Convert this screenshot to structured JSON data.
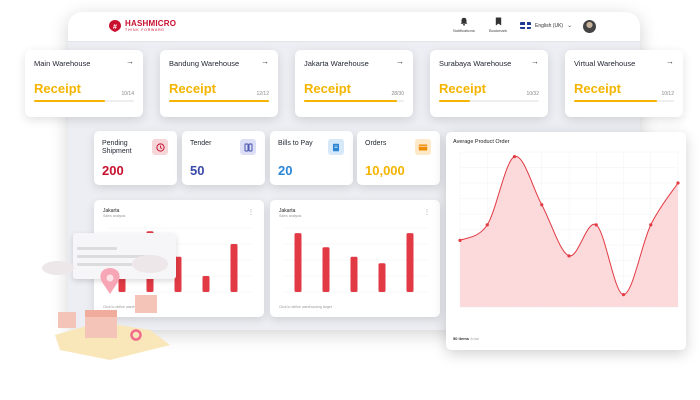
{
  "brand": {
    "name": "HASHMICRO",
    "tagline": "THINK FORWARD"
  },
  "topbar": {
    "notifications_label": "Notifications",
    "bookmark_label": "Bookmark",
    "language": "English (UK)"
  },
  "warehouses": [
    {
      "name": "Main Warehouse",
      "label": "Receipt",
      "count": "10/14",
      "progress": 0.71
    },
    {
      "name": "Bandung Warehouse",
      "label": "Receipt",
      "count": "12/12",
      "progress": 1.0
    },
    {
      "name": "Jakarta Warehouse",
      "label": "Receipt",
      "count": "28/30",
      "progress": 0.93
    },
    {
      "name": "Surabaya Warehouse",
      "label": "Receipt",
      "count": "10/32",
      "progress": 0.31
    },
    {
      "name": "Virtual Warehouse",
      "label": "Receipt",
      "count": "10/12",
      "progress": 0.83
    }
  ],
  "stats": [
    {
      "title": "Pending Shipment",
      "value": "200",
      "color": "#c8102e",
      "icon": "clock-icon",
      "icon_bg": "#f7d6d9",
      "icon_fg": "#c8102e"
    },
    {
      "title": "Tender",
      "value": "50",
      "color": "#3a49a8",
      "icon": "tender-icon",
      "icon_bg": "#dcdff5",
      "icon_fg": "#3a49a8"
    },
    {
      "title": "Bills to Pay",
      "value": "20",
      "color": "#2a86d6",
      "icon": "document-icon",
      "icon_bg": "#d7e8f8",
      "icon_fg": "#2a86d6"
    },
    {
      "title": "Orders",
      "value": "10,000",
      "color": "#f4b400",
      "icon": "box-icon",
      "icon_bg": "#fde9c7",
      "icon_fg": "#f08c00"
    }
  ],
  "bar_cards": [
    {
      "title": "Jakarta",
      "subtitle": "Sales analysis",
      "footer": "Click to define warehousing target",
      "bars": [
        0.55,
        0.95,
        0.55,
        0.25,
        0.75
      ]
    },
    {
      "title": "Jakarta",
      "subtitle": "Sales analysis",
      "footer": "Click to define warehousing target",
      "bars": [
        0.92,
        0.7,
        0.55,
        0.45,
        0.92
      ]
    }
  ],
  "avg_order": {
    "title": "Average Product Order",
    "footer_count": "50 items",
    "footer_suffix": "/total"
  },
  "colors": {
    "accent_yellow": "#f4b400",
    "accent_red": "#e23a44",
    "brand_red": "#c8102e"
  },
  "chart_data": [
    {
      "type": "area",
      "title": "Average Product Order",
      "x_count": 9,
      "points": [
        0.43,
        0.53,
        0.97,
        0.66,
        0.33,
        0.53,
        0.08,
        0.53,
        0.8
      ],
      "grid": true,
      "color": "#e23a44"
    },
    {
      "type": "bar",
      "title": "Jakarta",
      "values": [
        0.55,
        0.95,
        0.55,
        0.25,
        0.75
      ]
    },
    {
      "type": "bar",
      "title": "Jakarta",
      "values": [
        0.92,
        0.7,
        0.55,
        0.45,
        0.92
      ]
    }
  ]
}
